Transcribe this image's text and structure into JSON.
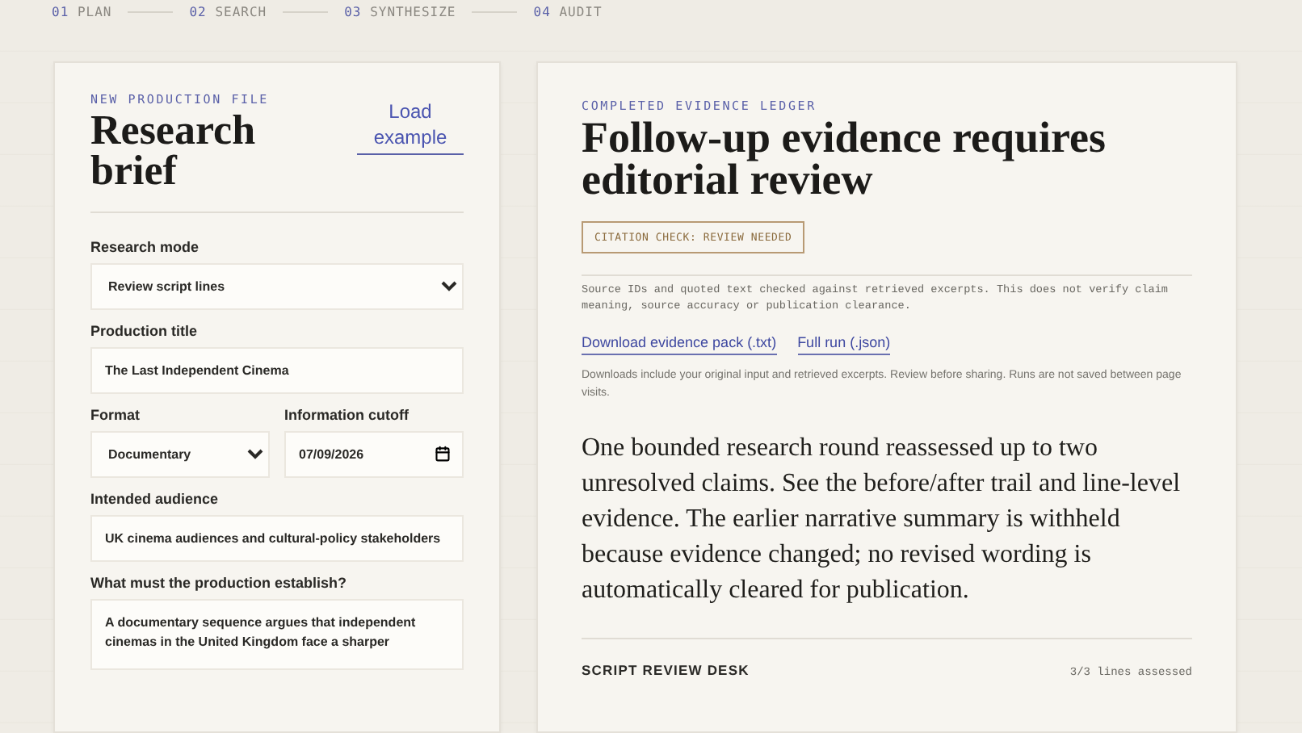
{
  "steps": [
    {
      "number": "01",
      "label": "PLAN"
    },
    {
      "number": "02",
      "label": "SEARCH"
    },
    {
      "number": "03",
      "label": "SYNTHESIZE"
    },
    {
      "number": "04",
      "label": "AUDIT"
    }
  ],
  "brief": {
    "eyebrow": "NEW PRODUCTION FILE",
    "title": "Research brief",
    "load_example": "Load example",
    "rows": [
      [
        {
          "kind": "select",
          "label": "Research mode",
          "value": "Review script lines"
        }
      ],
      [
        {
          "kind": "text",
          "label": "Production title",
          "value": "The Last Independent Cinema"
        }
      ],
      [
        {
          "kind": "select",
          "label": "Format",
          "value": "Documentary"
        },
        {
          "kind": "date",
          "label": "Information cutoff",
          "value": "07/09/2026"
        }
      ],
      [
        {
          "kind": "text",
          "label": "Intended audience",
          "value": "UK cinema audiences and cultural-policy stakeholders"
        }
      ],
      [
        {
          "kind": "textarea",
          "label": "What must the production establish?",
          "value": "A documentary sequence argues that independent cinemas in the United Kingdom face a sharper"
        }
      ]
    ]
  },
  "ledger": {
    "eyebrow": "COMPLETED EVIDENCE LEDGER",
    "title": "Follow-up evidence requires editorial review",
    "badge": "CITATION CHECK: REVIEW NEEDED",
    "note": "Source IDs and quoted text checked against retrieved excerpts. This does not verify claim meaning, source accuracy or publication clearance.",
    "links": [
      "Download evidence pack (.txt)",
      "Full run (.json)"
    ],
    "downloads_note": "Downloads include your original input and retrieved excerpts. Review before sharing. Runs are not saved between page visits.",
    "summary": "One bounded research round reassessed up to two unresolved claims. See the before/after trail and line-level evidence. The earlier narrative summary is withheld because evidence changed; no revised wording is automatically cleared for publication.",
    "section": {
      "title": "SCRIPT REVIEW DESK",
      "count": "3/3 lines assessed"
    }
  }
}
